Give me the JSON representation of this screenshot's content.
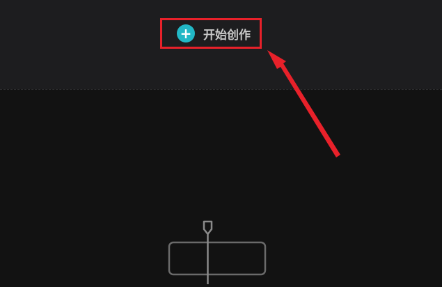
{
  "create": {
    "label": "开始创作",
    "icon": "plus-icon",
    "accent": "#22b8c6"
  },
  "annotation": {
    "color": "#e8212a"
  },
  "timeline": {
    "icon": "playhead-icon"
  }
}
